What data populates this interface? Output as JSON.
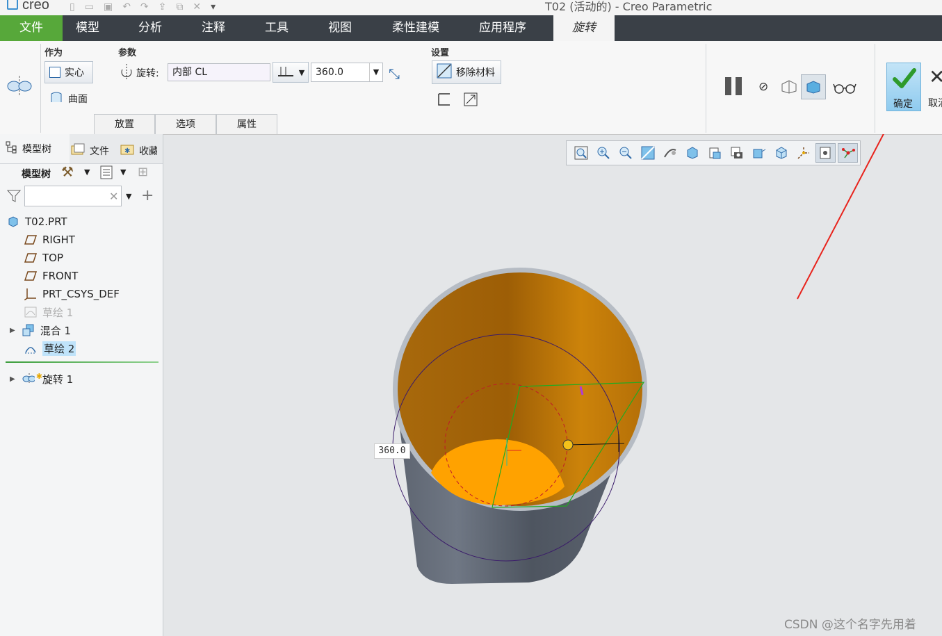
{
  "app": {
    "logo_text": "creo",
    "window_title": "T02 (活动的) - Creo Parametric"
  },
  "ribbon_tabs": [
    "文件",
    "模型",
    "分析",
    "注释",
    "工具",
    "视图",
    "柔性建模",
    "应用程序",
    "旋转"
  ],
  "active_tab": "旋转",
  "ribbon": {
    "as_group_label": "作为",
    "solid_label": "实心",
    "surface_label": "曲面",
    "params_group_label": "参数",
    "rotate_label": "旋转:",
    "axis_value": "内部 CL",
    "angle_value": "360.0",
    "settings_group_label": "设置",
    "remove_material_label": "移除材料",
    "subtabs": [
      "放置",
      "选项",
      "属性"
    ],
    "ok_label": "确定",
    "cancel_label": "取消"
  },
  "left_panel": {
    "tabs": [
      "模型树",
      "文件",
      "收藏"
    ],
    "tree_header": "模型树",
    "search_placeholder": "",
    "tree": [
      {
        "label": "T02.PRT",
        "icon": "part-icon",
        "level": 0
      },
      {
        "label": "RIGHT",
        "icon": "datum-plane-icon",
        "level": 1
      },
      {
        "label": "TOP",
        "icon": "datum-plane-icon",
        "level": 1
      },
      {
        "label": "FRONT",
        "icon": "datum-plane-icon",
        "level": 1
      },
      {
        "label": "PRT_CSYS_DEF",
        "icon": "csys-icon",
        "level": 1
      },
      {
        "label": "草绘 1",
        "icon": "sketch-icon",
        "level": 1,
        "dimmed": true
      },
      {
        "label": "混合 1",
        "icon": "blend-icon",
        "level": 1,
        "expandable": true
      },
      {
        "label": "草绘 2",
        "icon": "sketch-icon",
        "level": 1,
        "selected": true
      },
      {
        "label": "旋转 1",
        "icon": "revolve-icon",
        "level": 1,
        "expandable": true,
        "new": true
      }
    ]
  },
  "viewport": {
    "dimension_label": "360.0"
  },
  "watermark": "CSDN @这个名字先用着",
  "colors": {
    "file_tab": "#57a83a",
    "tabbar": "#3a4047",
    "viewport_bg": "#e4e6e8",
    "annotation_arrow": "#e8231c"
  }
}
